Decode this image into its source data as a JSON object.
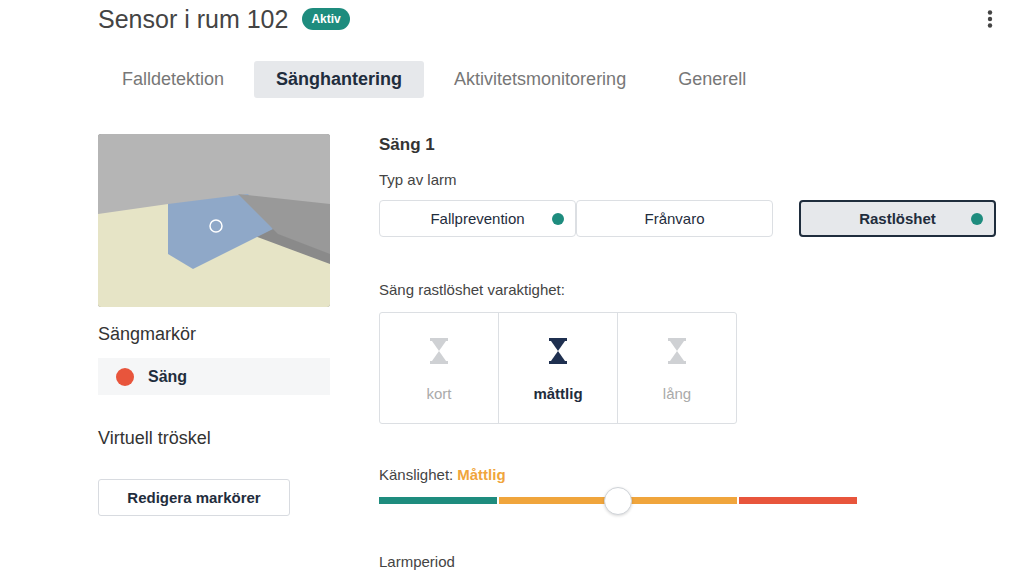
{
  "header": {
    "title": "Sensor i rum 102",
    "badge": "Aktiv"
  },
  "tabs": [
    {
      "label": "Falldetektion",
      "selected": false
    },
    {
      "label": "Sänghantering",
      "selected": true
    },
    {
      "label": "Aktivitetsmonitorering",
      "selected": false
    },
    {
      "label": "Generell",
      "selected": false
    }
  ],
  "bed_marker": {
    "title": "Sängmarkör",
    "items": [
      {
        "label": "Säng",
        "color": "#e8553c"
      }
    ]
  },
  "threshold": {
    "title": "Virtuell tröskel",
    "button": "Redigera markörer"
  },
  "bed": {
    "title": "Säng 1",
    "alarm_type_label": "Typ av larm",
    "alarm_types": [
      {
        "label": "Fallprevention",
        "selected": false,
        "enabled": true
      },
      {
        "label": "Frånvaro",
        "selected": false,
        "enabled": false
      },
      {
        "label": "Rastlöshet",
        "selected": true,
        "enabled": true
      }
    ],
    "duration_label": "Säng rastlöshet varaktighet:",
    "durations": [
      {
        "label": "kort",
        "selected": false
      },
      {
        "label": "måttlig",
        "selected": true
      },
      {
        "label": "lång",
        "selected": false
      }
    ],
    "sensitivity": {
      "label": "Känslighet:",
      "value": "Måttlig",
      "level": 0.5
    },
    "alarm_period_label": "Larmperiod"
  }
}
